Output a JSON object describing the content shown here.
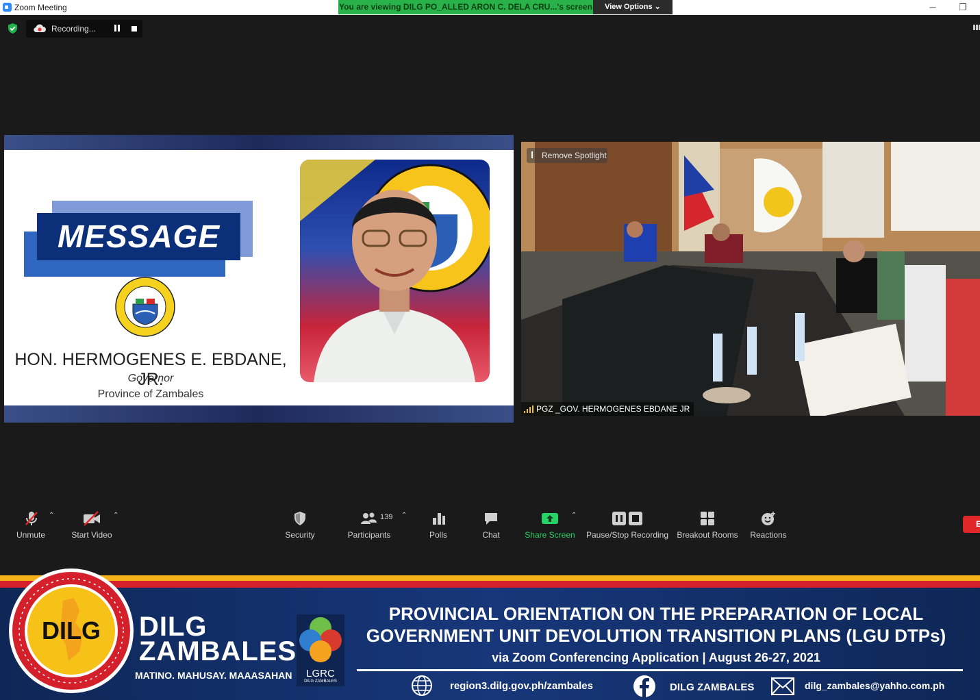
{
  "window": {
    "title": "Zoom Meeting",
    "banner": "You are viewing DILG PO_ALLED ARON C. DELA CRU...'s screen",
    "view_options": "View Options",
    "minimize": "─",
    "restore": "❐"
  },
  "recording": {
    "label": "Recording..."
  },
  "shared_slide": {
    "heading": "MESSAGE",
    "name": "HON. HERMOGENES E. EBDANE, JR.",
    "title": "Governor",
    "province": "Province of Zambales"
  },
  "video": {
    "spotlight_button": "Remove Spotlight",
    "participant_name": "PGZ _GOV. HERMOGENES EBDANE JR"
  },
  "toolbar": {
    "unmute": "Unmute",
    "start_video": "Start Video",
    "security": "Security",
    "participants": "Participants",
    "participant_count": "139",
    "polls": "Polls",
    "chat": "Chat",
    "share_screen": "Share Screen",
    "pause_stop_recording": "Pause/Stop Recording",
    "breakout_rooms": "Breakout Rooms",
    "reactions": "Reactions",
    "end": "E"
  },
  "lower_third": {
    "brand_line1": "DILG",
    "brand_line2": "ZAMBALES",
    "motto": "MATINO. MAHUSAY. MAAASAHAN",
    "lgrc": "LGRC",
    "lgrc_sub": "DILG ZAMBALES",
    "title_line1": "PROVINCIAL ORIENTATION ON THE PREPARATION OF LOCAL",
    "title_line2": "GOVERNMENT UNIT DEVOLUTION TRANSITION PLANS (LGU DTPs)",
    "subtitle": "via Zoom Conferencing Application | August 26-27, 2021",
    "website": "region3.dilg.gov.ph/zambales",
    "facebook": "DILG ZAMBALES",
    "email": "dilg_zambales@yahho.com.ph"
  },
  "colors": {
    "zoom_blue": "#2d8cff",
    "viewing_banner": "#2ab24a",
    "share_green": "#25d366",
    "end_red": "#e02828",
    "banner_navy": "#102a5e",
    "stripe_yellow": "#f6b21b",
    "stripe_red": "#d3202a"
  }
}
